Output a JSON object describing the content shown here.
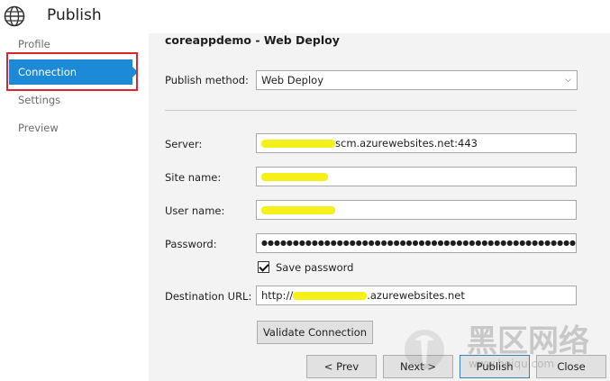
{
  "window": {
    "title": "Publish"
  },
  "sidebar": {
    "items": [
      {
        "label": "Profile"
      },
      {
        "label": "Connection"
      },
      {
        "label": "Settings"
      },
      {
        "label": "Preview"
      }
    ]
  },
  "main": {
    "heading": "coreappdemo - Web Deploy",
    "publish_method": {
      "label": "Publish method:",
      "value": "Web Deploy"
    },
    "server": {
      "label": "Server:",
      "value_suffix": "scm.azurewebsites.net:443"
    },
    "site_name": {
      "label": "Site name:"
    },
    "user_name": {
      "label": "User name:"
    },
    "password": {
      "label": "Password:",
      "value": "●●●●●●●●●●●●●●●●●●●●●●●●●●●●●●●●●●●●●●●●●●●●●●●●●●●●●●●●●●●●●●●●"
    },
    "save_password": {
      "label": "Save password",
      "checked": true
    },
    "destination_url": {
      "label": "Destination URL:",
      "value_prefix": "http://",
      "value_suffix": ".azurewebsites.net"
    },
    "validate_button": "Validate Connection"
  },
  "footer": {
    "prev": "< Prev",
    "next": "Next >",
    "publish": "Publish",
    "close": "Close"
  },
  "colors": {
    "accent": "#1c8ad6",
    "highlight": "#e0242a",
    "redaction": "#f5ef1a"
  }
}
